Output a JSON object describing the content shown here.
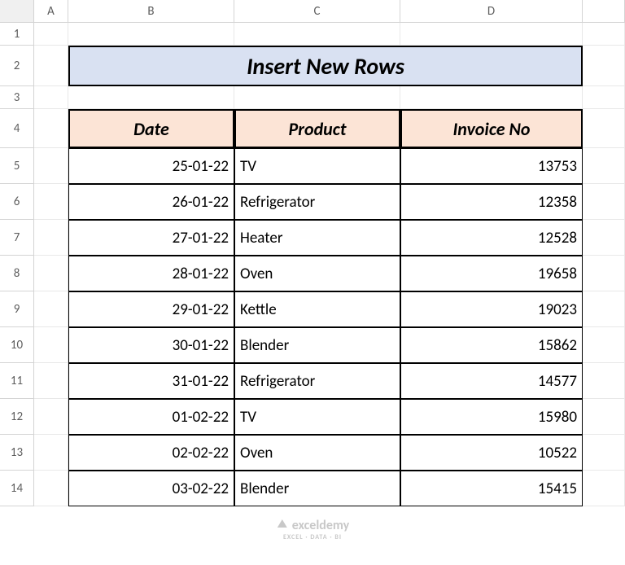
{
  "columns": [
    "A",
    "B",
    "C",
    "D"
  ],
  "rows": [
    "1",
    "2",
    "3",
    "4",
    "5",
    "6",
    "7",
    "8",
    "9",
    "10",
    "11",
    "12",
    "13",
    "14"
  ],
  "title": "Insert New Rows",
  "headers": {
    "date": "Date",
    "product": "Product",
    "invoice": "Invoice No"
  },
  "data": [
    {
      "date": "25-01-22",
      "product": "TV",
      "invoice": "13753"
    },
    {
      "date": "26-01-22",
      "product": "Refrigerator",
      "invoice": "12358"
    },
    {
      "date": "27-01-22",
      "product": "Heater",
      "invoice": "12528"
    },
    {
      "date": "28-01-22",
      "product": "Oven",
      "invoice": "19658"
    },
    {
      "date": "29-01-22",
      "product": "Kettle",
      "invoice": "19023"
    },
    {
      "date": "30-01-22",
      "product": "Blender",
      "invoice": "15862"
    },
    {
      "date": "31-01-22",
      "product": "Refrigerator",
      "invoice": "14577"
    },
    {
      "date": "01-02-22",
      "product": "TV",
      "invoice": "15980"
    },
    {
      "date": "02-02-22",
      "product": "Oven",
      "invoice": "10522"
    },
    {
      "date": "03-02-22",
      "product": "Blender",
      "invoice": "15415"
    }
  ],
  "watermark": {
    "main": "exceldemy",
    "sub": "EXCEL · DATA · BI"
  },
  "chart_data": {
    "type": "table",
    "title": "Insert New Rows",
    "columns": [
      "Date",
      "Product",
      "Invoice No"
    ],
    "rows": [
      [
        "25-01-22",
        "TV",
        13753
      ],
      [
        "26-01-22",
        "Refrigerator",
        12358
      ],
      [
        "27-01-22",
        "Heater",
        12528
      ],
      [
        "28-01-22",
        "Oven",
        19658
      ],
      [
        "29-01-22",
        "Kettle",
        19023
      ],
      [
        "30-01-22",
        "Blender",
        15862
      ],
      [
        "31-01-22",
        "Refrigerator",
        14577
      ],
      [
        "01-02-22",
        "TV",
        15980
      ],
      [
        "02-02-22",
        "Oven",
        10522
      ],
      [
        "03-02-22",
        "Blender",
        15415
      ]
    ]
  }
}
